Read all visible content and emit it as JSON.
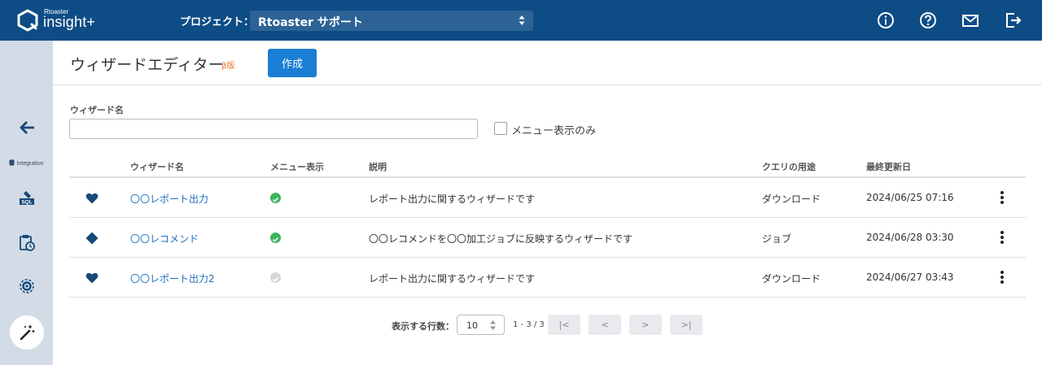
{
  "app": {
    "brand_small": "Rtoaster",
    "brand_big": "insight+"
  },
  "topbar": {
    "project_label": "プロジェクト：",
    "project_value": "Rtoaster サポート",
    "icons": [
      "info-icon",
      "help-icon",
      "mail-icon",
      "logout-icon"
    ]
  },
  "sidebar": {
    "integration_label": "Integration",
    "items": [
      "back-arrow-icon",
      "sql-icon",
      "clipboard-clock-icon",
      "settings-gear-icon",
      "magic-wand-icon"
    ]
  },
  "header": {
    "title": "ウィザードエディター",
    "beta": "β版",
    "create_label": "作成"
  },
  "filter": {
    "name_label": "ウィザード名",
    "name_value": "",
    "menu_only_label": "メニュー表示のみ"
  },
  "table": {
    "columns": [
      "ウィザード名",
      "メニュー表示",
      "説明",
      "クエリの用途",
      "最終更新日"
    ],
    "rows": [
      {
        "icon": "heart-icon",
        "name": "〇〇レポート出力",
        "menu": true,
        "desc": "レポート出力に関するウィザードです",
        "usage": "ダウンロード",
        "updated": "2024/06/25 07:16"
      },
      {
        "icon": "diamond-icon",
        "name": "〇〇レコメンド",
        "menu": true,
        "desc": "〇〇レコメンドを〇〇加工ジョブに反映するウィザードです",
        "usage": "ジョブ",
        "updated": "2024/06/28 03:30"
      },
      {
        "icon": "heart-icon",
        "name": "〇〇レポート出力2",
        "menu": false,
        "desc": "レポート出力に関するウィザードです",
        "usage": "ダウンロード",
        "updated": "2024/06/27 03:43"
      }
    ]
  },
  "pager": {
    "rows_label": "表示する行数：",
    "rows_value": "10",
    "range": "1 - 3 / 3",
    "first": "|<",
    "prev": "<",
    "next": ">",
    "last": ">|"
  },
  "colors": {
    "topbar": "#0e4c85",
    "sidebar": "#d3dce6",
    "primary": "#1a7fd4",
    "link": "#1f6fbf",
    "check_on": "#3cb55a",
    "check_off": "#d4d7db",
    "beta": "#e8742a"
  }
}
